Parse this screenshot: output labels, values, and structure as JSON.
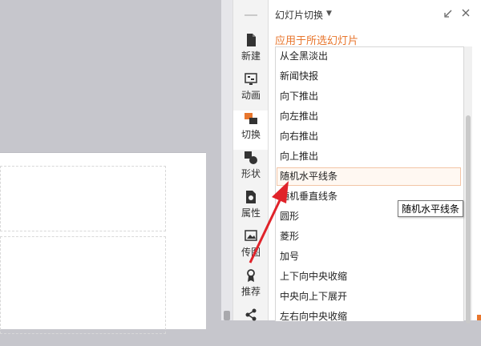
{
  "toolbar": {
    "items": [
      {
        "label": "新建",
        "icon": "new-icon"
      },
      {
        "label": "动画",
        "icon": "animation-icon"
      },
      {
        "label": "切换",
        "icon": "transition-icon",
        "active": true
      },
      {
        "label": "形状",
        "icon": "shape-icon"
      },
      {
        "label": "属性",
        "icon": "properties-icon"
      },
      {
        "label": "传图",
        "icon": "upload-image-icon"
      },
      {
        "label": "推荐",
        "icon": "recommend-icon"
      }
    ]
  },
  "pane": {
    "title": "幻灯片切换",
    "dropdown_glyph": "▼",
    "restore_glyph": "↙",
    "close_glyph": "✕",
    "apply_label": "应用于所选幻灯片",
    "transitions": [
      "从全黑淡出",
      "新闻快报",
      "向下推出",
      "向左推出",
      "向右推出",
      "向上推出",
      "随机水平线条",
      "随机垂直线条",
      "圆形",
      "菱形",
      "加号",
      "上下向中央收缩",
      "中央向上下展开",
      "左右向中央收缩"
    ],
    "hovered_index": 6
  },
  "tooltip": {
    "text": "随机水平线条"
  },
  "colors": {
    "accent": "#e8762d",
    "arrow": "#e0232a"
  }
}
